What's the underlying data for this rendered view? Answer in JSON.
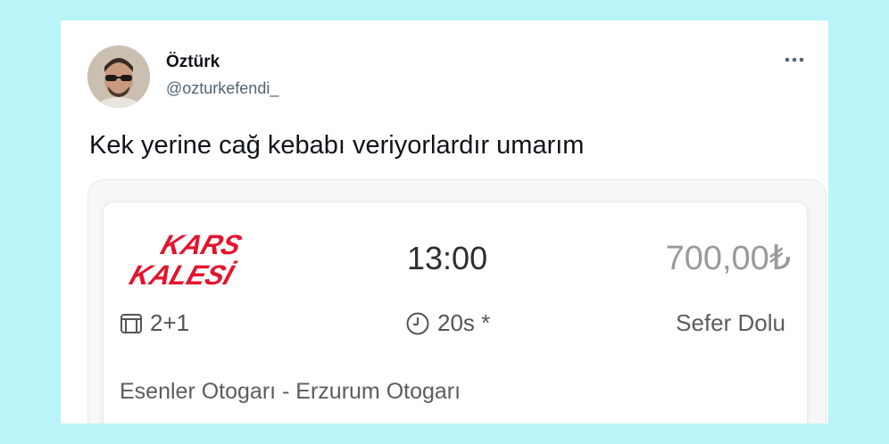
{
  "user": {
    "display_name": "Öztürk",
    "handle": "@ozturkefendi_"
  },
  "tweet": {
    "text": "Kek yerine cağ kebabı veriyorlardır umarım"
  },
  "ticket": {
    "company_logo_text": [
      "KARS",
      "KALESİ"
    ],
    "departure_time": "13:00",
    "price": "700,00₺",
    "seat_layout": "2+1",
    "duration": "20s *",
    "status": "Sefer Dolu",
    "route": "Esenler Otogarı - Erzurum Otogarı"
  },
  "colors": {
    "page_background": "#b9f5f8",
    "logo_red": "#e3142c"
  },
  "icons": {
    "more": "more-horizontal-icon",
    "seat": "seat-icon",
    "clock": "clock-icon"
  }
}
